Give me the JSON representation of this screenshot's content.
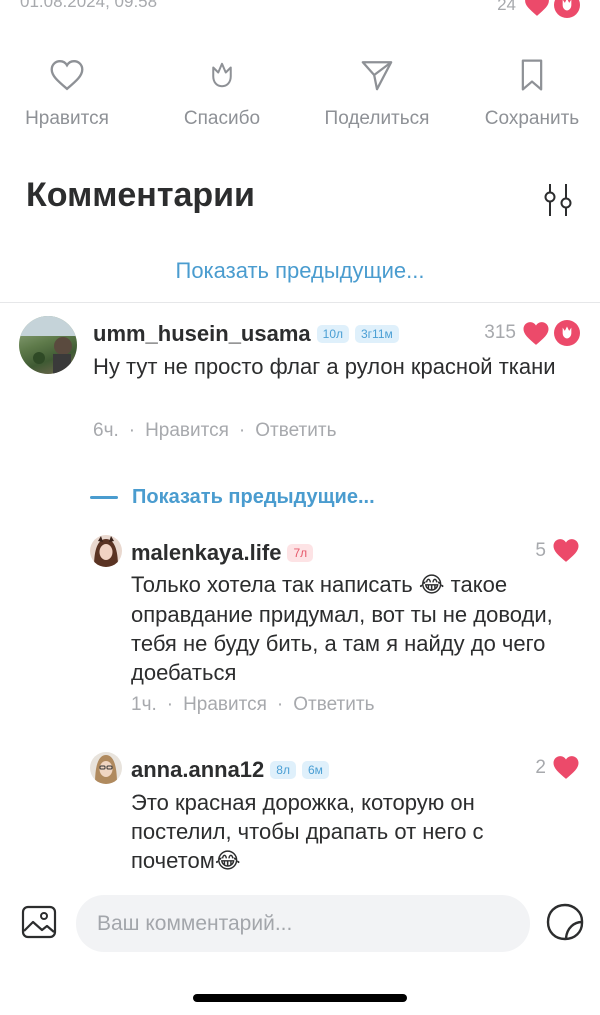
{
  "post": {
    "date": "01.08.2024, 09:58",
    "reactions_count": "24"
  },
  "actions": [
    {
      "label": "Нравится",
      "icon": "heart-outline-icon"
    },
    {
      "label": "Спасибо",
      "icon": "tulip-outline-icon"
    },
    {
      "label": "Поделиться",
      "icon": "send-icon"
    },
    {
      "label": "Сохранить",
      "icon": "bookmark-icon"
    }
  ],
  "comments_section": {
    "title": "Комментарии",
    "show_previous": "Показать предыдущие..."
  },
  "comments": [
    {
      "username": "umm_husein_usama",
      "badges": [
        "10л",
        "3г11м"
      ],
      "likes": "315",
      "text": "Ну тут не просто флаг а рулон красной ткани",
      "time": "6ч.",
      "like_label": "Нравится",
      "reply_label": "Ответить"
    }
  ],
  "replies_show_previous": "Показать предыдущие...",
  "replies": [
    {
      "username": "malenkaya.life",
      "badges": [
        "7л"
      ],
      "likes": "5",
      "text_before_emoji": "Только хотела так написать ",
      "emoji": "😂",
      "text_after_emoji": " такое оправдание придумал, вот ты не доводи, тебя не буду бить, а там я найду до чего доебаться",
      "time": "1ч.",
      "like_label": "Нравится",
      "reply_label": "Ответить"
    },
    {
      "username": "anna.anna12",
      "badges": [
        "8л",
        "6м"
      ],
      "likes": "2",
      "text": "Это красная дорожка, которую он постелил, чтобы драпать от него с почетом",
      "emoji": "😂"
    }
  ],
  "composer": {
    "placeholder": "Ваш комментарий..."
  },
  "colors": {
    "accent": "#4a9ccf",
    "heart": "#ec4a6a",
    "muted": "#a7a9ad"
  }
}
